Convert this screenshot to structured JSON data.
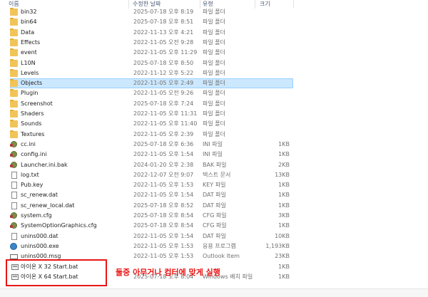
{
  "columns": {
    "name": "이름",
    "date": "수정한 날짜",
    "type": "유형",
    "size": "크기"
  },
  "rows": [
    {
      "name": "bin32",
      "date": "2025-07-18 오후 8:19",
      "type": "파일 폴더",
      "size": "",
      "icon": "folder-icon"
    },
    {
      "name": "bin64",
      "date": "2025-07-18 오후 8:51",
      "type": "파일 폴더",
      "size": "",
      "icon": "folder-icon"
    },
    {
      "name": "Data",
      "date": "2022-11-13 오후 4:21",
      "type": "파일 폴더",
      "size": "",
      "icon": "folder-icon"
    },
    {
      "name": "Effects",
      "date": "2022-11-05 오전 9:28",
      "type": "파일 폴더",
      "size": "",
      "icon": "folder-icon"
    },
    {
      "name": "event",
      "date": "2022-11-05 오후 11:29",
      "type": "파일 폴더",
      "size": "",
      "icon": "folder-icon"
    },
    {
      "name": "L10N",
      "date": "2025-07-18 오후 8:50",
      "type": "파일 폴더",
      "size": "",
      "icon": "folder-icon"
    },
    {
      "name": "Levels",
      "date": "2022-11-12 오후 5:22",
      "type": "파일 폴더",
      "size": "",
      "icon": "folder-icon"
    },
    {
      "name": "Objects",
      "date": "2022-11-05 오후 2:49",
      "type": "파일 폴더",
      "size": "",
      "icon": "folder-icon",
      "selected": true
    },
    {
      "name": "Plugin",
      "date": "2022-11-05 오전 9:26",
      "type": "파일 폴더",
      "size": "",
      "icon": "folder-icon"
    },
    {
      "name": "Screenshot",
      "date": "2025-07-18 오후 7:24",
      "type": "파일 폴더",
      "size": "",
      "icon": "folder-icon"
    },
    {
      "name": "Shaders",
      "date": "2022-11-05 오후 11:31",
      "type": "파일 폴더",
      "size": "",
      "icon": "folder-icon"
    },
    {
      "name": "Sounds",
      "date": "2022-11-05 오후 11:40",
      "type": "파일 폴더",
      "size": "",
      "icon": "folder-icon"
    },
    {
      "name": "Textures",
      "date": "2022-11-05 오후 2:39",
      "type": "파일 폴더",
      "size": "",
      "icon": "folder-icon"
    },
    {
      "name": "cc.ini",
      "date": "2025-07-18 오후 6:36",
      "type": "INI 파일",
      "size": "1KB",
      "icon": "settings-file-icon"
    },
    {
      "name": "config.ini",
      "date": "2022-11-05 오후 1:54",
      "type": "INI 파일",
      "size": "1KB",
      "icon": "settings-file-icon"
    },
    {
      "name": "Launcher.ini.bak",
      "date": "2024-01-20 오후 2:38",
      "type": "BAK 파일",
      "size": "2KB",
      "icon": "settings-file-icon"
    },
    {
      "name": "log.txt",
      "date": "2022-12-07 오전 9:07",
      "type": "텍스트 문서",
      "size": "13KB",
      "icon": "text-file-icon"
    },
    {
      "name": "Pub.key",
      "date": "2022-11-05 오후 1:53",
      "type": "KEY 파일",
      "size": "1KB",
      "icon": "file-icon"
    },
    {
      "name": "sc_renew.dat",
      "date": "2022-11-05 오후 1:54",
      "type": "DAT 파일",
      "size": "1KB",
      "icon": "file-icon"
    },
    {
      "name": "sc_renew_local.dat",
      "date": "2025-07-18 오후 8:52",
      "type": "DAT 파일",
      "size": "1KB",
      "icon": "file-icon"
    },
    {
      "name": "system.cfg",
      "date": "2025-07-18 오후 8:54",
      "type": "CFG 파일",
      "size": "3KB",
      "icon": "settings-file-icon"
    },
    {
      "name": "SystemOptionGraphics.cfg",
      "date": "2025-07-18 오후 8:54",
      "type": "CFG 파일",
      "size": "1KB",
      "icon": "settings-file-icon"
    },
    {
      "name": "unins000.dat",
      "date": "2022-11-05 오후 1:54",
      "type": "DAT 파일",
      "size": "10KB",
      "icon": "file-icon"
    },
    {
      "name": "unins000.exe",
      "date": "2022-11-05 오후 1:53",
      "type": "응용 프로그램",
      "size": "1,193KB",
      "icon": "installer-icon"
    },
    {
      "name": "unins000.msg",
      "date": "2022-11-05 오후 1:53",
      "type": "Outlook Item",
      "size": "23KB",
      "icon": "mail-icon"
    },
    {
      "name": "아이온 X 32 Start.bat",
      "date": "",
      "type": "",
      "size": "1KB",
      "icon": "batch-file-icon"
    },
    {
      "name": "아이온 X 64 Start.bat",
      "date": "2025-07-18 오후 8:04",
      "type": "Windows 배치 파일",
      "size": "1KB",
      "icon": "batch-file-icon"
    }
  ],
  "annotation": "둘중 아무거나 컴터에 맞게 실행",
  "colors": {
    "selected_bg": "#cce8ff",
    "annotation": "#e81515",
    "folder": "#f1c45a"
  }
}
